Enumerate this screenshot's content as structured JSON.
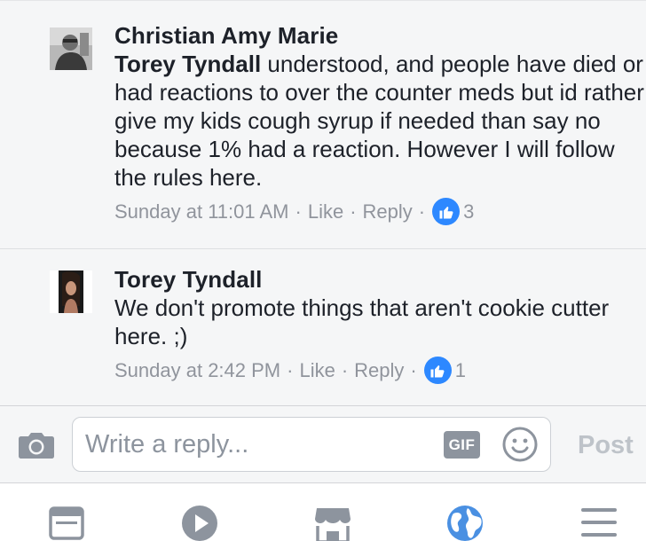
{
  "comments": [
    {
      "author": "Christian Amy Marie",
      "mention": "Torey Tyndall",
      "text": " understood, and people have died or had reactions to over the counter meds but id rather give my kids cough syrup if needed than say no because 1% had a reaction. However I will follow the rules here.",
      "timestamp": "Sunday at 11:01 AM",
      "like_label": "Like",
      "reply_label": "Reply",
      "like_count": "3"
    },
    {
      "author": "Torey Tyndall",
      "mention": "",
      "text": "We don't promote things that aren't cookie cutter here. ;)",
      "timestamp": "Sunday at 2:42 PM",
      "like_label": "Like",
      "reply_label": "Reply",
      "like_count": "1"
    }
  ],
  "composer": {
    "placeholder": "Write a reply...",
    "value": "",
    "gif_label": "GIF",
    "post_label": "Post"
  },
  "icons": {
    "camera": "camera-icon",
    "gif": "gif-icon",
    "emoji": "emoji-icon",
    "news_feed": "news-feed-icon",
    "video": "video-icon",
    "marketplace": "marketplace-icon",
    "notifications": "globe-icon",
    "menu": "menu-icon"
  },
  "colors": {
    "accent": "#2d88ff",
    "active_tab": "#4a90e2",
    "inactive_icon": "#8d949e",
    "meta_text": "#90949c",
    "body_text": "#1d2129"
  }
}
